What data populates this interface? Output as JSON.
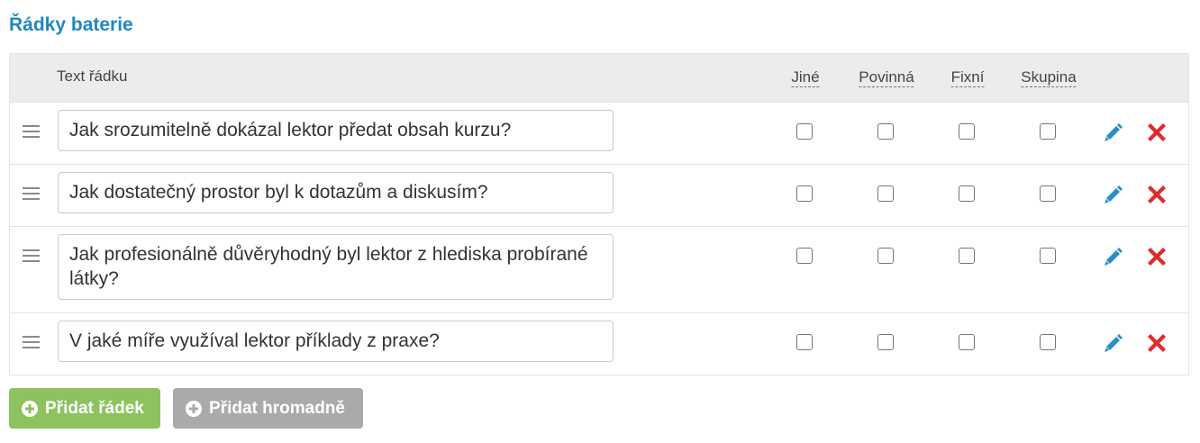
{
  "section_title": "Řádky baterie",
  "columns": {
    "text": "Text řádku",
    "other": "Jiné",
    "required": "Povinná",
    "fixed": "Fixní",
    "group": "Skupina"
  },
  "rows": [
    {
      "text": "Jak srozumitelně dokázal lektor předat obsah kurzu?",
      "other": false,
      "required": false,
      "fixed": false,
      "group": false
    },
    {
      "text": "Jak dostatečný prostor byl k dotazům a diskusím?",
      "other": false,
      "required": false,
      "fixed": false,
      "group": false
    },
    {
      "text": "Jak profesionálně důvěryhodný byl lektor z hlediska probírané látky?",
      "other": false,
      "required": false,
      "fixed": false,
      "group": false
    },
    {
      "text": "V jaké míře využíval lektor příklady z praxe?",
      "other": false,
      "required": false,
      "fixed": false,
      "group": false
    }
  ],
  "buttons": {
    "add_row": "Přidat řádek",
    "add_bulk": "Přidat hromadně"
  },
  "icons": {
    "drag": "drag-handle-icon",
    "edit": "pencil-icon",
    "delete": "close-icon",
    "add": "plus-circle-icon"
  },
  "colors": {
    "title": "#1f87c0",
    "add_button": "#8dc25e",
    "bulk_button": "#aaaaaa",
    "edit_icon": "#2a8fc8",
    "delete_icon": "#dd2c2c"
  }
}
